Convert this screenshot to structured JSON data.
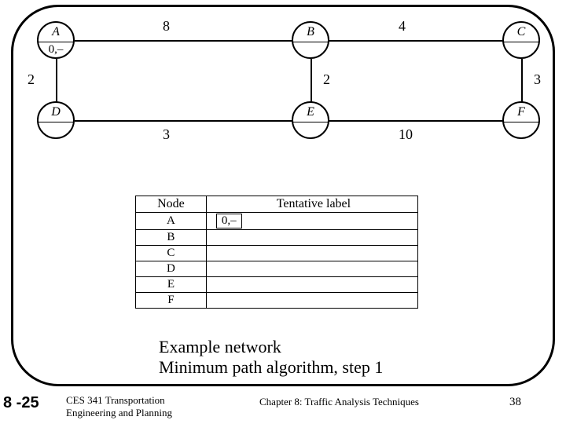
{
  "graph": {
    "nodes": {
      "A": {
        "label": "A",
        "cost": "0,–"
      },
      "B": {
        "label": "B",
        "cost": ""
      },
      "C": {
        "label": "C",
        "cost": ""
      },
      "D": {
        "label": "D",
        "cost": ""
      },
      "E": {
        "label": "E",
        "cost": ""
      },
      "F": {
        "label": "F",
        "cost": ""
      }
    },
    "edges": {
      "AB": "8",
      "BC": "4",
      "AD": "2",
      "BE": "2",
      "CF": "3",
      "DE": "3",
      "EF": "10"
    }
  },
  "table": {
    "header_node": "Node",
    "header_label": "Tentative label",
    "rows": [
      {
        "node": "A",
        "label": "0,–",
        "boxed": true
      },
      {
        "node": "B",
        "label": "",
        "boxed": false
      },
      {
        "node": "C",
        "label": "",
        "boxed": false
      },
      {
        "node": "D",
        "label": "",
        "boxed": false
      },
      {
        "node": "E",
        "label": "",
        "boxed": false
      },
      {
        "node": "F",
        "label": "",
        "boxed": false
      }
    ]
  },
  "caption": {
    "line1": "Example network",
    "line2": "Minimum path algorithm, step 1"
  },
  "footer": {
    "section": "8 -25",
    "course_line1": "CES 341 Transportation",
    "course_line2": "Engineering and Planning",
    "chapter": "Chapter 8: Traffic Analysis Techniques",
    "page": "38"
  }
}
